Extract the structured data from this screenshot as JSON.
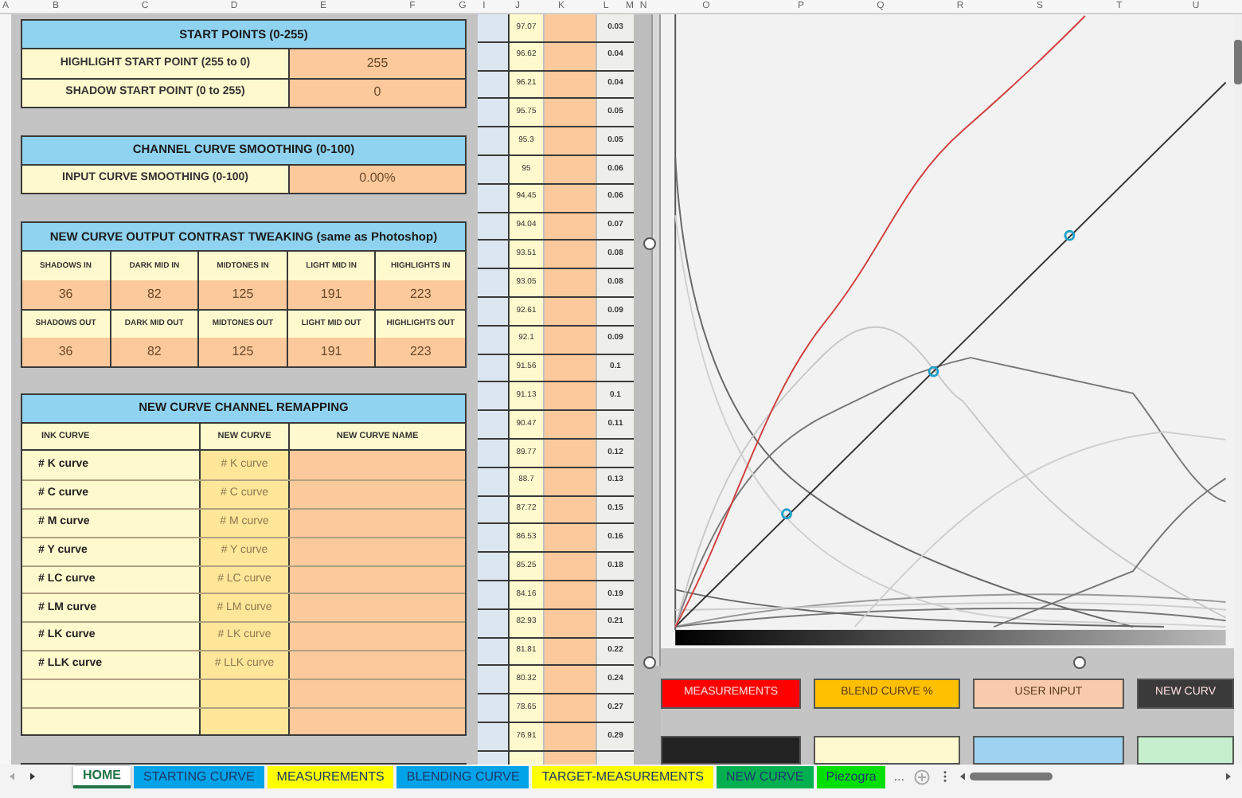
{
  "column_headers": [
    "A",
    "B",
    "C",
    "D",
    "E",
    "F",
    "G",
    "I",
    "J",
    "K",
    "L",
    "M",
    "N",
    "O",
    "P",
    "Q",
    "R",
    "S",
    "T",
    "U"
  ],
  "start_points": {
    "title": "START POINTS (0-255)",
    "rows": [
      {
        "label": "HIGHLIGHT START POINT (255 to 0)",
        "value": "255"
      },
      {
        "label": "SHADOW START POINT (0 to 255)",
        "value": "0"
      }
    ]
  },
  "channel_smoothing": {
    "title": "CHANNEL CURVE SMOOTHING (0-100)",
    "rows": [
      {
        "label": "INPUT CURVE SMOOTHING (0-100)",
        "value": "0.00%"
      }
    ]
  },
  "contrast_tweaking": {
    "title": "NEW CURVE OUTPUT CONTRAST TWEAKING (same as Photoshop)",
    "in_labels": [
      "SHADOWS IN",
      "DARK MID IN",
      "MIDTONES IN",
      "LIGHT MID IN",
      "HIGHLIGHTS IN"
    ],
    "in_values": [
      "36",
      "82",
      "125",
      "191",
      "223"
    ],
    "out_labels": [
      "SHADOWS OUT",
      "DARK MID OUT",
      "MIDTONES OUT",
      "LIGHT MID OUT",
      "HIGHLIGHTS OUT"
    ],
    "out_values": [
      "36",
      "82",
      "125",
      "191",
      "223"
    ]
  },
  "remapping": {
    "title": "NEW CURVE CHANNEL REMAPPING",
    "columns": [
      "INK CURVE",
      "NEW CURVE",
      "NEW CURVE NAME"
    ],
    "rows": [
      {
        "ink_curve": "# K curve",
        "new_curve": "# K curve"
      },
      {
        "ink_curve": "# C curve",
        "new_curve": "# C curve"
      },
      {
        "ink_curve": "# M curve",
        "new_curve": "# M curve"
      },
      {
        "ink_curve": "# Y curve",
        "new_curve": "# Y curve"
      },
      {
        "ink_curve": "# LC curve",
        "new_curve": "# LC curve"
      },
      {
        "ink_curve": "# LM curve",
        "new_curve": "# LM curve"
      },
      {
        "ink_curve": "# LK curve",
        "new_curve": "# LK curve"
      },
      {
        "ink_curve": "# LLK curve",
        "new_curve": "# LLK curve"
      }
    ]
  },
  "value_rows": [
    {
      "column_j": "97.07",
      "column_l": "0.03"
    },
    {
      "column_j": "96.62",
      "column_l": "0.04"
    },
    {
      "column_j": "96.21",
      "column_l": "0.04"
    },
    {
      "column_j": "95.75",
      "column_l": "0.05"
    },
    {
      "column_j": "95.3",
      "column_l": "0.05"
    },
    {
      "column_j": "95",
      "column_l": "0.06"
    },
    {
      "column_j": "94.45",
      "column_l": "0.06"
    },
    {
      "column_j": "94.04",
      "column_l": "0.07"
    },
    {
      "column_j": "93.51",
      "column_l": "0.08"
    },
    {
      "column_j": "93.05",
      "column_l": "0.08"
    },
    {
      "column_j": "92.61",
      "column_l": "0.09"
    },
    {
      "column_j": "92.1",
      "column_l": "0.09"
    },
    {
      "column_j": "91.56",
      "column_l": "0.1"
    },
    {
      "column_j": "91.13",
      "column_l": "0.1"
    },
    {
      "column_j": "90.47",
      "column_l": "0.11"
    },
    {
      "column_j": "89.77",
      "column_l": "0.12"
    },
    {
      "column_j": "88.7",
      "column_l": "0.13"
    },
    {
      "column_j": "87.72",
      "column_l": "0.15"
    },
    {
      "column_j": "86.53",
      "column_l": "0.16"
    },
    {
      "column_j": "85.25",
      "column_l": "0.18"
    },
    {
      "column_j": "84.16",
      "column_l": "0.19"
    },
    {
      "column_j": "82.93",
      "column_l": "0.21"
    },
    {
      "column_j": "81.81",
      "column_l": "0.22"
    },
    {
      "column_j": "80.32",
      "column_l": "0.24"
    },
    {
      "column_j": "78.65",
      "column_l": "0.27"
    },
    {
      "column_j": "76.91",
      "column_l": "0.29"
    }
  ],
  "legend": [
    {
      "label": "MEASUREMENTS",
      "color": "#ff0000"
    },
    {
      "label": "BLEND CURVE %",
      "color": "#ffc000"
    },
    {
      "label": "USER INPUT",
      "color": "#f8cbad"
    },
    {
      "label": "NEW CURV",
      "color": "#3a3a3a"
    }
  ],
  "legend_row_2": [
    {
      "color": "#222222"
    },
    {
      "color": "#fff9d0"
    },
    {
      "color": "#9dd3f0"
    },
    {
      "color": "#c6efce"
    }
  ],
  "sheet_tabs": [
    {
      "label": "HOME",
      "color": "#ffffff",
      "selected": true
    },
    {
      "label": "STARTING CURVE",
      "color": "#00a2e8",
      "selected": false
    },
    {
      "label": "MEASUREMENTS",
      "color": "#ffff00",
      "selected": false
    },
    {
      "label": "BLENDING CURVE",
      "color": "#00a2e8",
      "selected": false
    },
    {
      "label": "TARGET-MEASUREMENTS",
      "color": "#ffff00",
      "selected": false
    },
    {
      "label": "NEW CURVE",
      "color": "#00b050",
      "selected": false
    },
    {
      "label": "Piezogra",
      "color": "#00e000",
      "selected": false
    }
  ],
  "tab_overflow": "..."
}
